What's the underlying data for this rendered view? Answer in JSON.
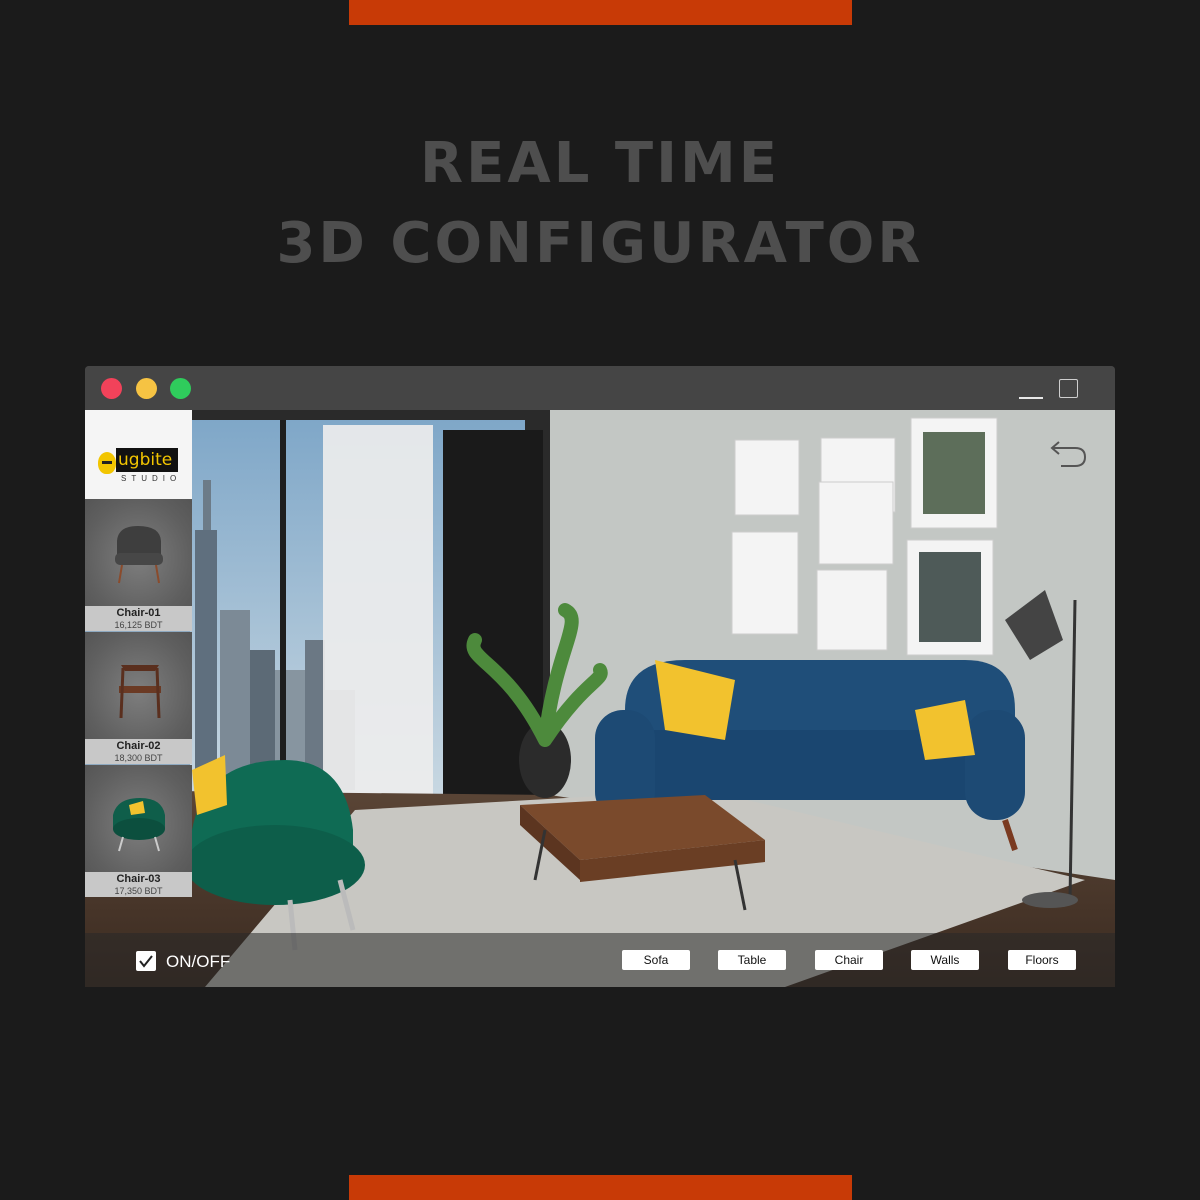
{
  "headline": {
    "line1": "REAL TIME",
    "line2": "3D CONFIGURATOR"
  },
  "colors": {
    "accent": "#c83a06",
    "background": "#1b1b1b",
    "headline": "#4e4e4e",
    "sofa": "#1f4e79",
    "armchair": "#0f6b54",
    "pillow": "#f2c22e"
  },
  "window": {
    "controls": [
      "close-dot",
      "minimize-dot",
      "maximize-dot"
    ],
    "right_controls": [
      "minimize-icon",
      "maximize-icon"
    ]
  },
  "logo": {
    "word": "ugbite",
    "sub": "STUDIO"
  },
  "catalog": [
    {
      "name": "Chair-01",
      "price": "16,125 BDT"
    },
    {
      "name": "Chair-02",
      "price": "18,300 BDT"
    },
    {
      "name": "Chair-03",
      "price": "17,350 BDT"
    }
  ],
  "undo_icon": "undo-icon",
  "toggle": {
    "label": "ON/OFF",
    "checked": true
  },
  "buttons": {
    "sofa": "Sofa",
    "table": "Table",
    "chair": "Chair",
    "walls": "Walls",
    "floors": "Floors"
  }
}
